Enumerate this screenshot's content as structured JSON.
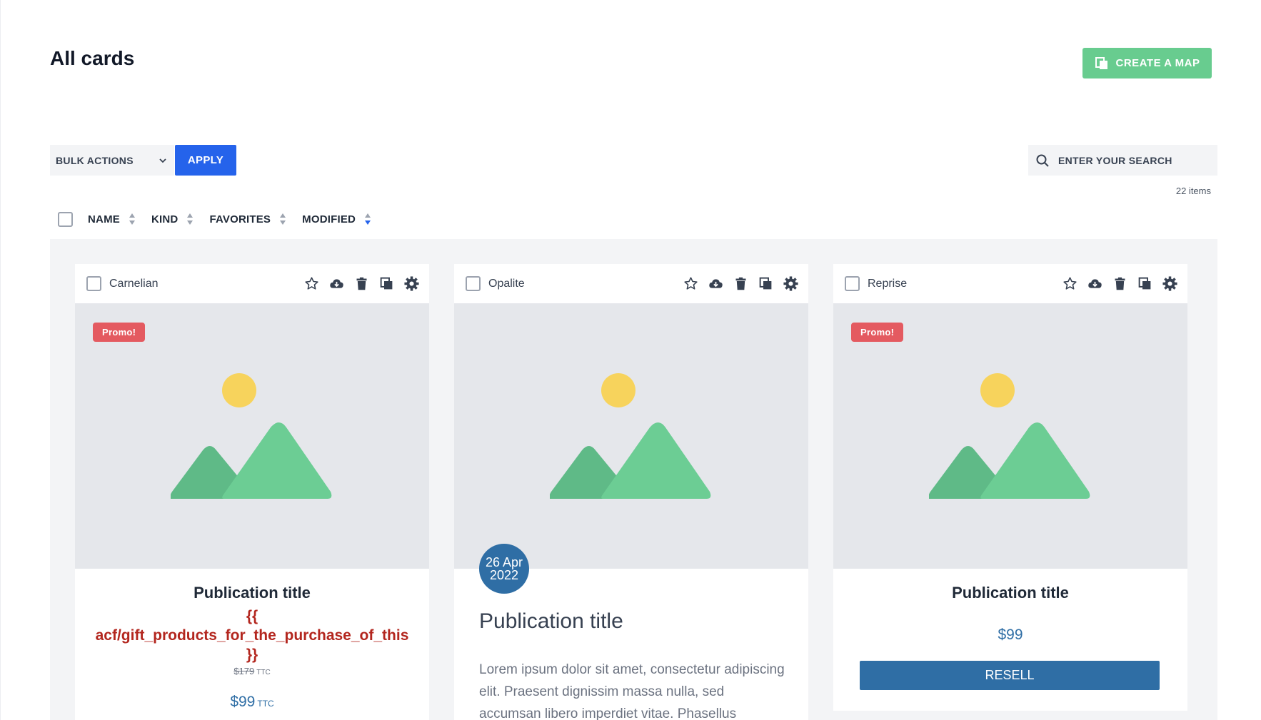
{
  "page": {
    "title": "All cards",
    "create_button": "CREATE A MAP"
  },
  "toolbar": {
    "bulk_actions": "BULK ACTIONS",
    "apply": "APPLY",
    "search_placeholder": "ENTER YOUR SEARCH",
    "items_count": "22 items"
  },
  "sort": {
    "columns": [
      "NAME",
      "KIND",
      "FAVORITES",
      "MODIFIED"
    ],
    "active": "MODIFIED"
  },
  "colors": {
    "accent_green": "#68cc8f",
    "accent_blue": "#2563eb",
    "promo_red": "#e45a60",
    "price_blue": "#2f6ea5",
    "error_red": "#b3261e"
  },
  "cards": [
    {
      "name": "Carnelian",
      "promo": "Promo!",
      "title": "Publication title",
      "acf_open": "{{",
      "acf_field": "acf/gift_products_for_the_purchase_of_this",
      "acf_close": "}}",
      "old_price": "$179",
      "old_price_unit": "TTC",
      "price": "$99",
      "price_unit": "TTC"
    },
    {
      "name": "Opalite",
      "date_day": "26 Apr",
      "date_year": "2022",
      "title": "Publication title",
      "excerpt": "Lorem ipsum dolor sit amet, consectetur adipiscing elit. Praesent dignissim massa nulla, sed accumsan libero imperdiet vitae. Phasellus"
    },
    {
      "name": "Reprise",
      "promo": "Promo!",
      "title": "Publication title",
      "price": "$99",
      "action": "RESELL"
    }
  ],
  "card_action_icons": [
    "star-icon",
    "cloud-download-icon",
    "trash-icon",
    "duplicate-icon",
    "gear-icon"
  ]
}
